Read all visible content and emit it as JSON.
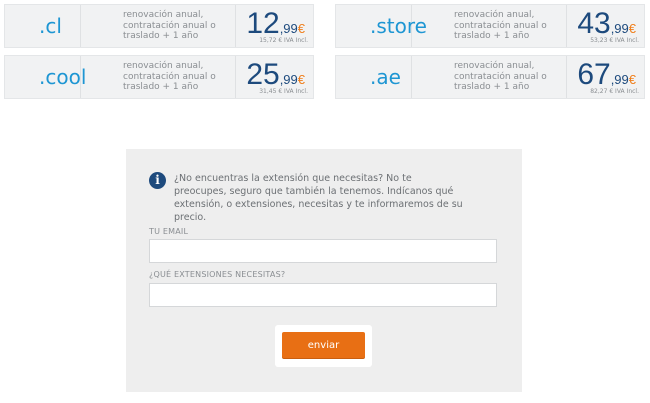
{
  "domains": [
    {
      "ext": ".cl",
      "desc": "renovación anual, contratación anual o traslado + 1 año",
      "int": "12",
      "dec": ",99",
      "cur": "€",
      "iva": "15,72 € IVA Incl."
    },
    {
      "ext": ".store",
      "desc": "renovación anual, contratación anual o traslado + 1 año",
      "int": "43",
      "dec": ",99",
      "cur": "€",
      "iva": "53,23 € IVA Incl."
    },
    {
      "ext": ".cool",
      "desc": "renovación anual, contratación anual o traslado + 1 año",
      "int": "25",
      "dec": ",99",
      "cur": "€",
      "iva": "31,45 € IVA Incl."
    },
    {
      "ext": ".ae",
      "desc": "renovación anual, contratación anual o traslado + 1 año",
      "int": "67",
      "dec": ",99",
      "cur": "€",
      "iva": "82,27 € IVA Incl."
    }
  ],
  "form": {
    "info_icon": "info-icon",
    "info_text": "¿No encuentras la extensión que necesitas? No te preocupes, seguro que también la tenemos. Indícanos qué extensión, o extensiones, necesitas y te informaremos de su precio.",
    "email_label": "TU EMAIL",
    "email_value": "",
    "extensions_label": "¿QUÉ EXTENSIONES NECESITAS?",
    "extensions_value": "",
    "submit_label": "enviar"
  },
  "colors": {
    "accent_blue": "#1e96d3",
    "price_navy": "#1d4a7d",
    "currency_orange": "#f07f1c",
    "button_orange": "#e86f14"
  }
}
